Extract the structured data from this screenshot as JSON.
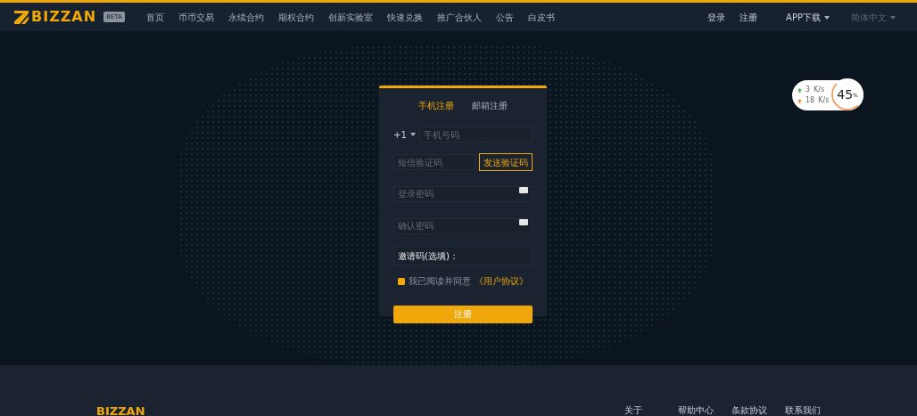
{
  "header": {
    "logo": "BIZZAN",
    "badge": "BETA",
    "nav": [
      {
        "label": "首页"
      },
      {
        "label": "币币交易"
      },
      {
        "label": "永续合约"
      },
      {
        "label": "期权合约"
      },
      {
        "label": "创新实验室"
      },
      {
        "label": "快速兑换"
      },
      {
        "label": "推广合伙人"
      },
      {
        "label": "公告"
      },
      {
        "label": "白皮书"
      }
    ],
    "login": "登录",
    "register": "注册",
    "app_download": "APP下载",
    "language": "简体中文"
  },
  "speed": {
    "up": "3",
    "up_unit": "K/s",
    "down": "18",
    "down_unit": "K/s",
    "percent": "45",
    "percent_sign": "%"
  },
  "form": {
    "tabs": [
      {
        "label": "手机注册",
        "selected": true
      },
      {
        "label": "邮箱注册",
        "selected": false
      }
    ],
    "country_code": "+1",
    "phone_placeholder": "手机号码",
    "sms_placeholder": "短信验证码",
    "send_code": "发送验证码",
    "password_placeholder": "登录密码",
    "confirm_placeholder": "确认密码",
    "invite_label": "邀请码(选填)：",
    "agree_checked": true,
    "agree_text": "我已阅读并同意",
    "agreement_link": "《用户协议》",
    "submit": "注册"
  },
  "footer": {
    "logo": "BIZZAN",
    "links": [
      "关于",
      "帮助中心",
      "条款协议",
      "联系我们"
    ]
  }
}
